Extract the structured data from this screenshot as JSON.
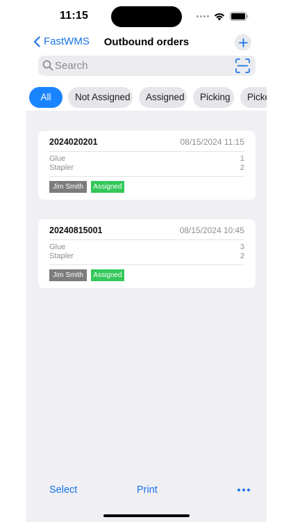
{
  "status_bar": {
    "time": "11:15"
  },
  "nav": {
    "back_label": "FastWMS",
    "title": "Outbound orders",
    "accent_color": "#1a73e8"
  },
  "search": {
    "placeholder": "Search",
    "value": ""
  },
  "filters": [
    {
      "label": "All",
      "active": true
    },
    {
      "label": "Not Assigned",
      "active": false
    },
    {
      "label": "Assigned",
      "active": false
    },
    {
      "label": "Picking",
      "active": false
    },
    {
      "label": "Picked",
      "active": false
    }
  ],
  "orders": [
    {
      "id": "2024020201",
      "date": "08/15/2024 11:15",
      "items": [
        {
          "name": "Glue",
          "qty": "1"
        },
        {
          "name": "Stapler",
          "qty": "2"
        }
      ],
      "assignee": "Jim Smith",
      "status": "Assigned"
    },
    {
      "id": "20240815001",
      "date": "08/15/2024 10:45",
      "items": [
        {
          "name": "Glue",
          "qty": "3"
        },
        {
          "name": "Stapler",
          "qty": "2"
        }
      ],
      "assignee": "Jim Smith",
      "status": "Assigned"
    }
  ],
  "toolbar": {
    "select_label": "Select",
    "print_label": "Print"
  },
  "icons": {
    "back": "chevron-left-icon",
    "add": "plus-icon",
    "search": "magnifier-icon",
    "scan": "barcode-scan-icon",
    "more": "ellipsis-icon"
  },
  "colors": {
    "active_chip": "#1a84ff",
    "status_assigned": "#34c759",
    "assignee_tag": "#7c7c7c"
  }
}
